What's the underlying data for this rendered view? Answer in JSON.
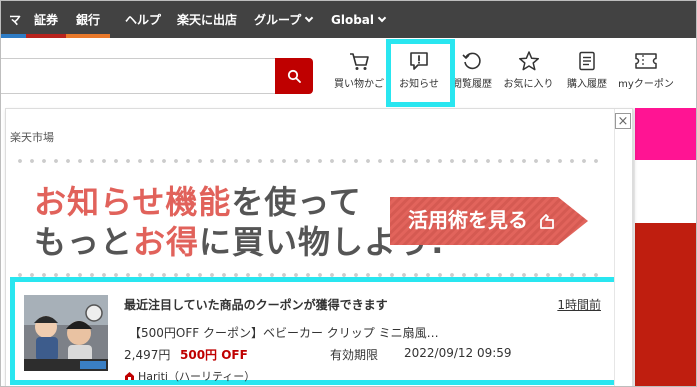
{
  "topnav": {
    "items": [
      {
        "label": "マ"
      },
      {
        "label": "証券"
      },
      {
        "label": "銀行"
      },
      {
        "label": "ヘルプ"
      },
      {
        "label": "楽天に出店"
      },
      {
        "label": "グループ"
      },
      {
        "label": "Global"
      }
    ]
  },
  "search": {
    "value": ""
  },
  "header_icons": [
    {
      "label": "買い物かご",
      "icon": "cart-icon"
    },
    {
      "label": "お知らせ",
      "icon": "notice-icon"
    },
    {
      "label": "閲覧履歴",
      "icon": "history-icon"
    },
    {
      "label": "お気に入り",
      "icon": "star-icon"
    },
    {
      "label": "購入履歴",
      "icon": "purchase-history-icon"
    },
    {
      "label": "myクーポン",
      "icon": "coupon-icon"
    }
  ],
  "panel": {
    "title": "楽天市場",
    "close_icon": "×",
    "banner": {
      "line1_accent": "お知らせ機能",
      "line1_rest": "を使って",
      "line2_a": "もっと",
      "line2_accent1": "お得",
      "line2_b": "に買い物しよう!",
      "cta": "活用術を見る"
    }
  },
  "notification": {
    "title": "最近注目していた商品のクーポンが獲得できます",
    "time": "1時間前",
    "product": "【500円OFF クーポン】ベビーカー クリップ ミニ扇風…",
    "price": "2,497円",
    "discount": "500円 OFF",
    "expiry_label": "有効期限",
    "expiry_value": "2022/09/12 09:59",
    "shop": "Hariti（ハーリティー）"
  },
  "colors": {
    "rakuten_red": "#bf0000",
    "highlight": "#29e6f0",
    "nav_bg": "#424242",
    "banner_accent": "#e1625b"
  }
}
